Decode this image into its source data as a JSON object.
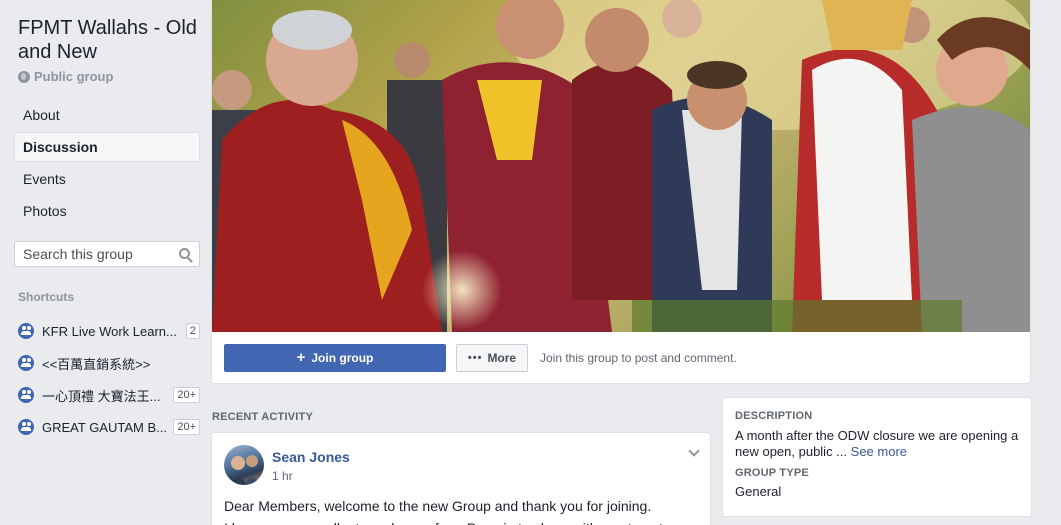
{
  "group": {
    "title": "FPMT Wallahs - Old and New",
    "privacy": "Public group"
  },
  "nav": {
    "items": [
      {
        "label": "About"
      },
      {
        "label": "Discussion"
      },
      {
        "label": "Events"
      },
      {
        "label": "Photos"
      }
    ]
  },
  "search": {
    "placeholder": "Search this group"
  },
  "shortcuts": {
    "label": "Shortcuts",
    "items": [
      {
        "label": "KFR Live Work Learn...",
        "badge": "2"
      },
      {
        "label": "<<百萬直銷系統>>",
        "badge": ""
      },
      {
        "label": "一心頂禮 大寶法王...",
        "badge": "20+"
      },
      {
        "label": "GREAT GAUTAM B...",
        "badge": "20+"
      }
    ]
  },
  "actions": {
    "join_label": "Join group",
    "more_label": "More",
    "join_hint": "Join this group to post and comment."
  },
  "recent": {
    "label": "RECENT ACTIVITY",
    "post": {
      "author": "Sean Jones",
      "time": "1 hr",
      "line1": "Dear Members, welcome to the new Group and thank you for joining.",
      "line2": "I have some excellent good news from Pomaia to share with you to get"
    }
  },
  "description": {
    "heading": "DESCRIPTION",
    "text": "A month after the ODW closure we are opening a new open, public ...",
    "see_more": "See more",
    "type_heading": "GROUP TYPE",
    "type_value": "General"
  },
  "colors": {
    "accent": "#4267b2",
    "link": "#385898",
    "background": "#e9ebee"
  },
  "icons": [
    "globe-icon",
    "search-icon",
    "group-icon",
    "plus-icon",
    "dots-icon",
    "chevron-down-icon"
  ]
}
